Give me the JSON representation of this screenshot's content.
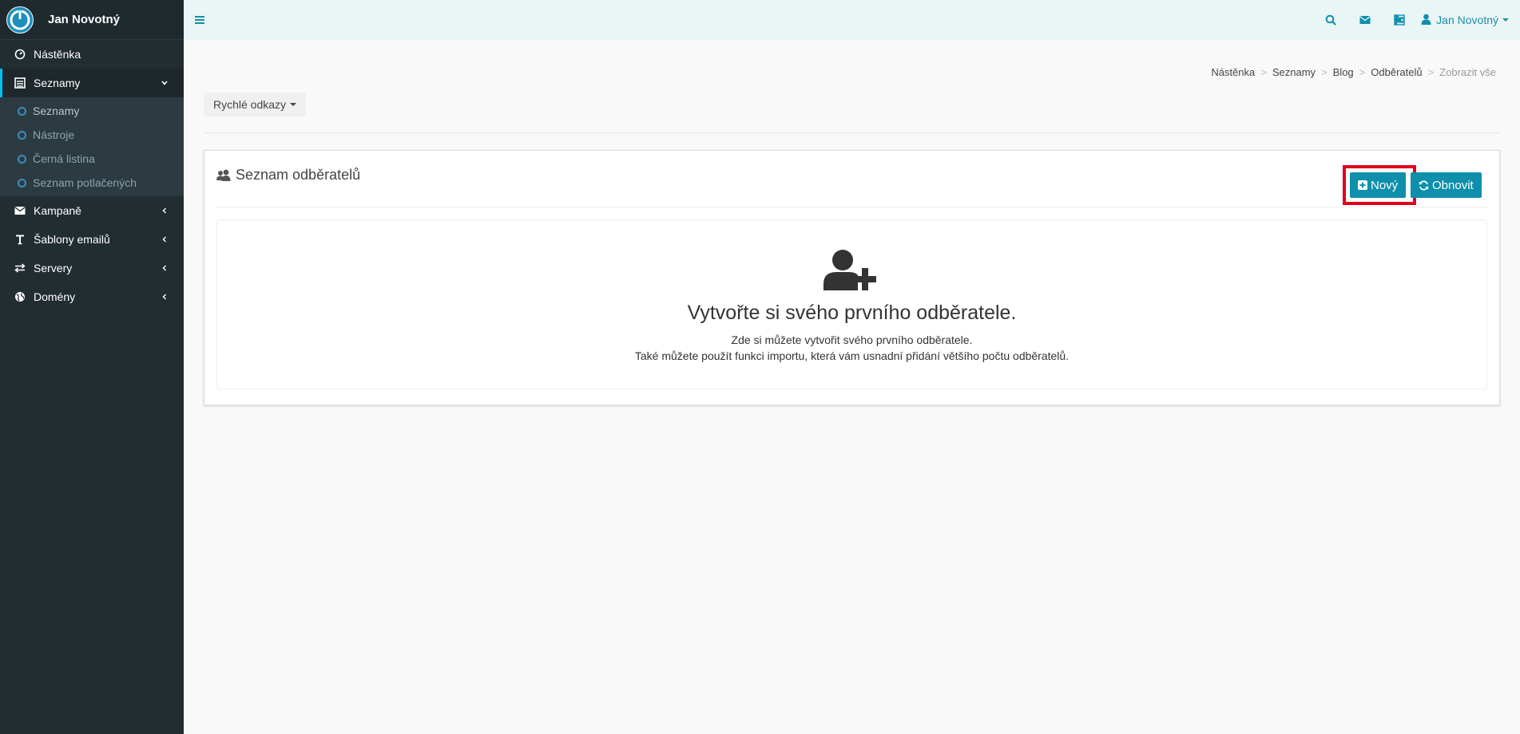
{
  "brand": {
    "name": "Jan Novotný"
  },
  "sidebar": {
    "items": [
      {
        "label": "Nástěnka",
        "icon": "dashboard-icon"
      },
      {
        "label": "Seznamy",
        "icon": "list-icon",
        "active": true
      },
      {
        "label": "Kampaně",
        "icon": "envelope-icon"
      },
      {
        "label": "Šablony emailů",
        "icon": "text-icon"
      },
      {
        "label": "Servery",
        "icon": "exchange-icon"
      },
      {
        "label": "Domény",
        "icon": "globe-icon"
      }
    ],
    "subitems": [
      {
        "label": "Seznamy"
      },
      {
        "label": "Nástroje"
      },
      {
        "label": "Černá listina"
      },
      {
        "label": "Seznam potlačených"
      }
    ]
  },
  "topbar": {
    "user": "Jan Novotný",
    "icons": [
      "search-icon",
      "envelope-icon",
      "tasks-icon",
      "user-icon"
    ]
  },
  "breadcrumb": [
    "Nástěnka",
    "Seznamy",
    "Blog",
    "Odběratelů",
    "Zobrazit vše"
  ],
  "quick_links": {
    "label": "Rychlé odkazy"
  },
  "panel": {
    "title": "Seznam odběratelů",
    "new_label": "Nový",
    "refresh_label": "Obnovit"
  },
  "empty_state": {
    "title": "Vytvořte si svého prvního odběratele.",
    "line1": "Zde si můžete vytvořit svého prvního odběratele.",
    "line2": "Také můžete použít funkci importu, která vám usnadní přidání většího počtu odběratelů."
  },
  "colors": {
    "sidebar": "#222d32",
    "accent": "#0e8fab",
    "highlight": "#e0001b",
    "topbar": "#eaf5f6"
  }
}
